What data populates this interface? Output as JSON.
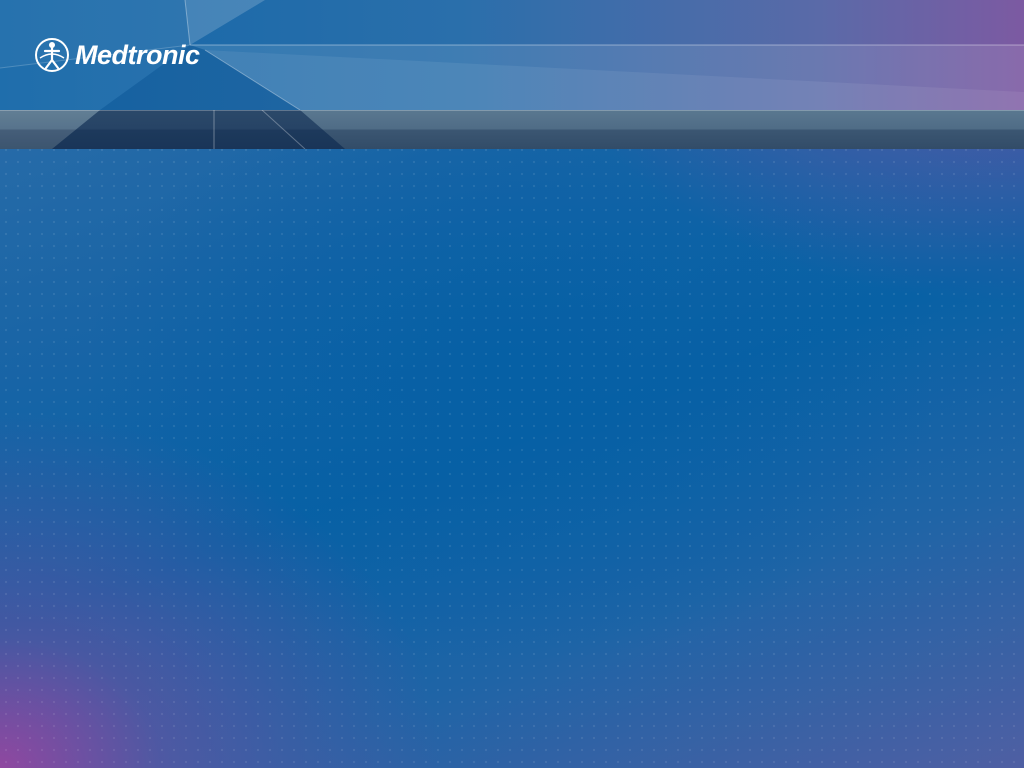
{
  "brand": {
    "name": "Medtronic",
    "logo_icon": "medtronic-figure-logo-icon"
  },
  "colors": {
    "primary_blue": "#0861a5",
    "accent_purple": "#8e4aa0",
    "band_gray": "#4f6c86",
    "logo_white": "#ffffff"
  }
}
